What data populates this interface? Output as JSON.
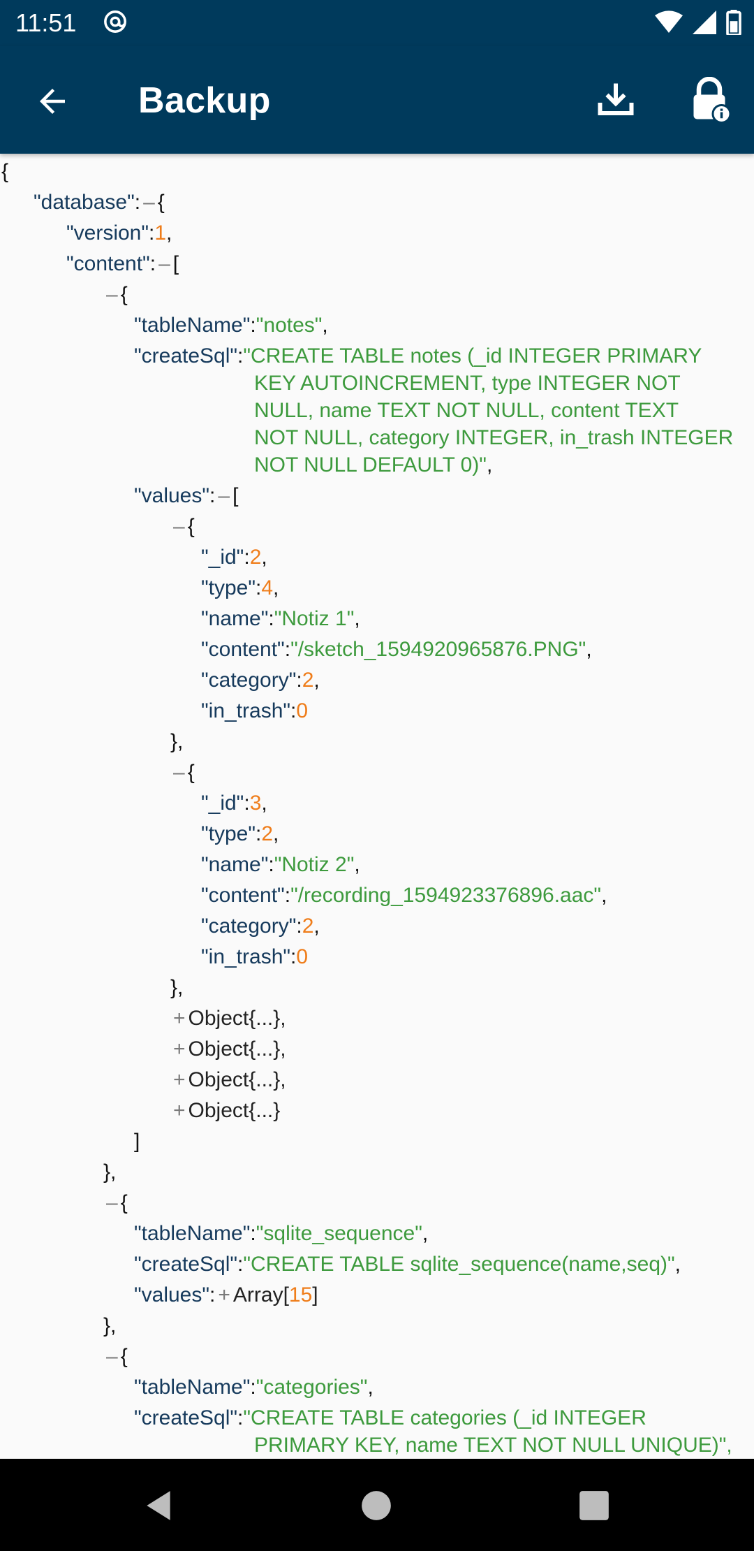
{
  "status_bar": {
    "time": "11:51"
  },
  "app_bar": {
    "title": "Backup"
  },
  "json_viewer": {
    "open_brace": "{",
    "database_key": "\"database\"",
    "version_key": "\"version\"",
    "version_val": "1",
    "content_key": "\"content\"",
    "table1": {
      "tableName_key": "\"tableName\"",
      "tableName_val": "\"notes\"",
      "createSql_key": "\"createSql\"",
      "createSql_lines": [
        "\"CREATE TABLE notes (_id INTEGER PRIMARY",
        "KEY AUTOINCREMENT, type INTEGER NOT",
        "NULL, name TEXT NOT NULL, content TEXT",
        "NOT NULL, category INTEGER, in_trash INTEGER",
        "NOT NULL DEFAULT 0)\""
      ],
      "values_key": "\"values\"",
      "obj1": {
        "_id_key": "\"_id\"",
        "_id_val": "2",
        "type_key": "\"type\"",
        "type_val": "4",
        "name_key": "\"name\"",
        "name_val": "\"Notiz 1\"",
        "content_key": "\"content\"",
        "content_val": "\"/sketch_1594920965876.PNG\"",
        "category_key": "\"category\"",
        "category_val": "2",
        "in_trash_key": "\"in_trash\"",
        "in_trash_val": "0"
      },
      "obj2": {
        "_id_key": "\"_id\"",
        "_id_val": "3",
        "type_key": "\"type\"",
        "type_val": "2",
        "name_key": "\"name\"",
        "name_val": "\"Notiz 2\"",
        "content_key": "\"content\"",
        "content_val": "\"/recording_1594923376896.aac\"",
        "category_key": "\"category\"",
        "category_val": "2",
        "in_trash_key": "\"in_trash\"",
        "in_trash_val": "0"
      },
      "collapsed_objects": [
        "Object{...},",
        "Object{...},",
        "Object{...},",
        "Object{...}"
      ]
    },
    "table2": {
      "tableName_key": "\"tableName\"",
      "tableName_val": "\"sqlite_sequence\"",
      "createSql_key": "\"createSql\"",
      "createSql_val": "\"CREATE TABLE sqlite_sequence(name,seq)\"",
      "values_key": "\"values\"",
      "values_collapsed": "Array[",
      "values_count": "15",
      "values_close": "]"
    },
    "table3": {
      "tableName_key": "\"tableName\"",
      "tableName_val": "\"categories\"",
      "createSql_key": "\"createSql\"",
      "createSql_lines": [
        "\"CREATE TABLE categories (_id INTEGER",
        "PRIMARY KEY, name TEXT NOT NULL UNIQUE)\","
      ]
    }
  },
  "colors": {
    "app_bar": "#003a5c",
    "key": "#163a5c",
    "string": "#3d9a3d",
    "number": "#ef7d1a",
    "background": "#fafafa"
  },
  "icons": [
    "at-sign-icon",
    "wifi-icon",
    "signal-icon",
    "battery-icon",
    "back-arrow-icon",
    "download-icon",
    "lock-info-icon",
    "nav-back-icon",
    "nav-home-icon",
    "nav-recents-icon"
  ]
}
